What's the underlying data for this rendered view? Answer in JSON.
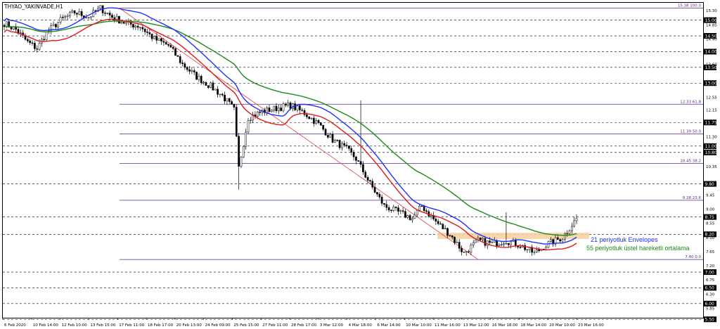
{
  "window": {
    "symbol_title": "THYAO_YAKINVADE,H1"
  },
  "annotations": {
    "envelope_text": "21 periyotluk Envelopes",
    "ma_text": "55 periyotluk üstel hareketli ortalama"
  },
  "colors": {
    "background": "#ffffff",
    "bull_candle": "#3a3a3a",
    "bear_candle": "#000000",
    "envelope_upper": "#1f2fff",
    "envelope_lower": "#e01a1a",
    "ema55": "#1a8a1a",
    "fib_line": "#5a2a8a",
    "trend_line": "#e25050",
    "support_zone": "#f8d0a0",
    "envelope_label": "#1f2fff",
    "ema_label": "#1a8a1a",
    "price_tag_bg": "#000000",
    "price_tag_fg": "#ffffff"
  },
  "chart_data": {
    "type": "table",
    "chart_kind": "candlestick",
    "timeframe": "H1",
    "title": "THYAO_YAKINVADE,H1",
    "ylim": [
      5.55,
      15.55
    ],
    "y_tick_labels": [
      "15.30",
      "15.05",
      "14.85",
      "14.50",
      "14.40",
      "14.00",
      "13.60",
      "13.00",
      "12.55",
      "12.15",
      "11.75",
      "11.30",
      "10.80",
      "10.35",
      "9.80",
      "9.45",
      "9.00",
      "8.75",
      "8.55",
      "8.20",
      "8.10",
      "7.65",
      "7.20",
      "7.00",
      "6.75",
      "6.30",
      "6.00",
      "5.85"
    ],
    "x_tick_labels": [
      "6 Feb 2020",
      "10 Feb 14:00",
      "12 Feb 10:00",
      "13 Feb 15:00",
      "17 Feb 11:00",
      "18 Feb 17:00",
      "20 Feb 13:00",
      "24 Feb 09:00",
      "25 Feb 15:00",
      "27 Feb 11:00",
      "28 Feb 17:00",
      "3 Mar 12:00",
      "4 Mar 18:00",
      "6 Mar 14:00",
      "10 Mar 10:00",
      "11 Mar 16:00",
      "13 Mar 12:00",
      "16 Mar 18:00",
      "18 Mar 14:00",
      "20 Mar 10:00",
      "23 Mar 16:00"
    ],
    "fibonacci_levels": [
      {
        "label": "15.38 100.0",
        "value": 15.38
      },
      {
        "label": "12.33 61.8",
        "value": 12.33
      },
      {
        "label": "11.39 50.0",
        "value": 11.39
      },
      {
        "label": "10.45 38.2",
        "value": 10.45
      },
      {
        "label": "9.28 23.6",
        "value": 9.28
      },
      {
        "label": "7.40 0.0",
        "value": 7.4
      }
    ],
    "price_tags": [
      "15.00",
      "14.50",
      "14.00",
      "13.50",
      "13.00",
      "11.75",
      "11.00",
      "10.80",
      "9.80",
      "8.75",
      "8.20",
      "7.00",
      "6.50",
      "6.00",
      "5.50"
    ],
    "horizontal_levels": [
      15.0,
      14.5,
      14.0,
      13.5,
      13.0,
      11.75,
      11.0,
      10.8,
      9.8,
      8.75,
      8.2,
      7.0,
      6.5,
      6.0,
      5.5
    ],
    "support_zone": [
      8.05,
      8.25
    ],
    "trend_line": {
      "from": 15.38,
      "to": 7.4
    },
    "series": [
      {
        "name": "21 periyotluk Envelopes"
      },
      {
        "name": "55 periyotluk üstel hareketli ortalama"
      }
    ],
    "price_path": [
      [
        0,
        14.9
      ],
      [
        5,
        14.7
      ],
      [
        10,
        14.3
      ],
      [
        14,
        14.1
      ],
      [
        18,
        14.6
      ],
      [
        24,
        15.0
      ],
      [
        30,
        15.25
      ],
      [
        36,
        15.1
      ],
      [
        41,
        15.38
      ],
      [
        46,
        15.1
      ],
      [
        52,
        14.9
      ],
      [
        58,
        14.8
      ],
      [
        64,
        14.4
      ],
      [
        70,
        14.2
      ],
      [
        76,
        13.6
      ],
      [
        82,
        13.2
      ],
      [
        88,
        12.9
      ],
      [
        93,
        12.6
      ],
      [
        98,
        12.15
      ],
      [
        100,
        10.3
      ],
      [
        104,
        11.9
      ],
      [
        110,
        12.1
      ],
      [
        116,
        12.2
      ],
      [
        122,
        12.3
      ],
      [
        128,
        12.05
      ],
      [
        134,
        11.7
      ],
      [
        140,
        11.2
      ],
      [
        146,
        10.9
      ],
      [
        150,
        10.6
      ],
      [
        156,
        9.8
      ],
      [
        162,
        9.1
      ],
      [
        168,
        8.9
      ],
      [
        174,
        8.7
      ],
      [
        178,
        9.1
      ],
      [
        184,
        8.6
      ],
      [
        190,
        8.2
      ],
      [
        196,
        7.6
      ],
      [
        202,
        8.0
      ],
      [
        208,
        7.9
      ],
      [
        214,
        8.0
      ],
      [
        220,
        7.85
      ],
      [
        226,
        7.6
      ],
      [
        232,
        7.9
      ],
      [
        238,
        8.1
      ],
      [
        244,
        8.7
      ]
    ]
  }
}
